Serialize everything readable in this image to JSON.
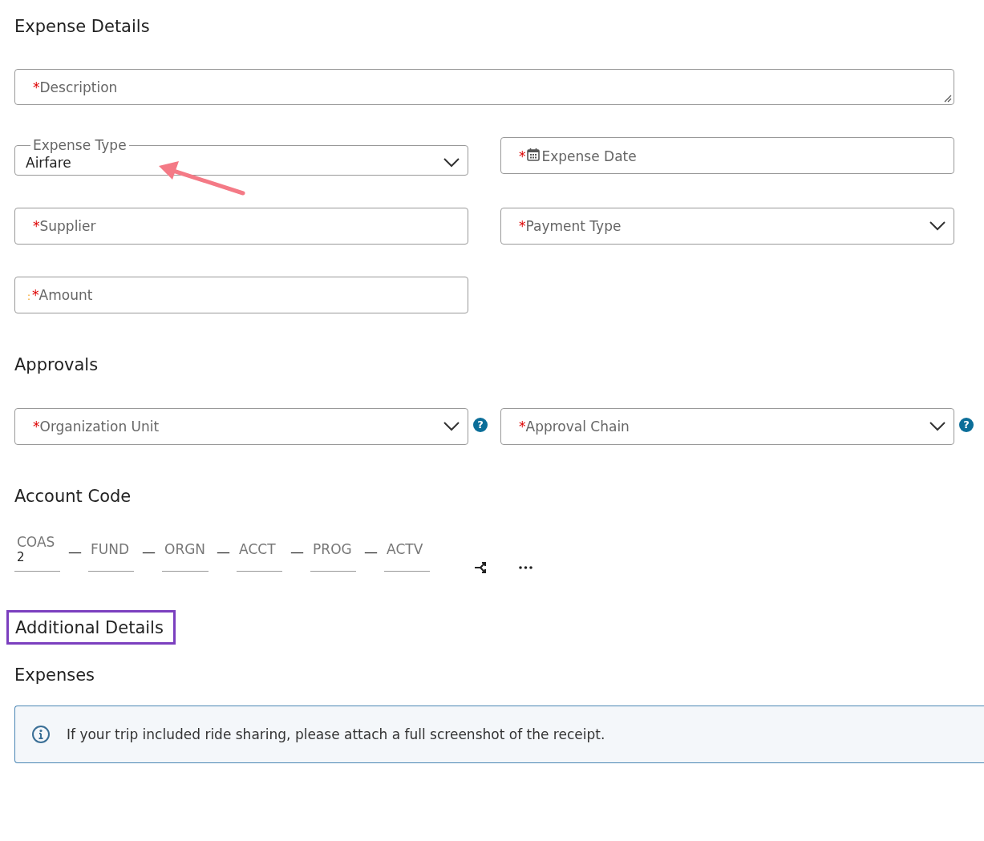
{
  "expense_details": {
    "title": "Expense Details",
    "fields": [
      {
        "kind": "textarea",
        "required_mark": "*",
        "label": "Description"
      },
      {
        "kind": "select",
        "legend": "Expense Type",
        "value": "Airfare"
      },
      {
        "kind": "date",
        "required_mark": "*",
        "label": "Expense Date"
      },
      {
        "kind": "text",
        "required_mark": "*",
        "label": "Supplier"
      },
      {
        "kind": "select",
        "required_mark": "*",
        "label": "Payment Type"
      },
      {
        "kind": "text",
        "prefix": ":",
        "required_mark": "*",
        "label": "Amount"
      }
    ],
    "annotation_arrow": true
  },
  "approvals": {
    "title": "Approvals",
    "fields": [
      {
        "kind": "select",
        "required_mark": "*",
        "label": "Organization Unit",
        "help": "?"
      },
      {
        "kind": "select",
        "required_mark": "*",
        "label": "Approval Chain",
        "help": "?"
      }
    ]
  },
  "account_code": {
    "title": "Account Code",
    "segments": [
      {
        "label": "COAS",
        "value": "2"
      },
      {
        "separator": "—",
        "label": "FUND"
      },
      {
        "separator": "—",
        "label": "ORGN"
      },
      {
        "separator": "—",
        "label": "ACCT"
      },
      {
        "separator": "—",
        "label": "PROG"
      },
      {
        "separator": "—",
        "label": "ACTV"
      }
    ]
  },
  "additional_details": {
    "title": "Additional Details",
    "highlighted": true
  },
  "expenses": {
    "title": "Expenses",
    "notice": "If your trip included ride sharing, please attach a full screenshot of the receipt."
  }
}
